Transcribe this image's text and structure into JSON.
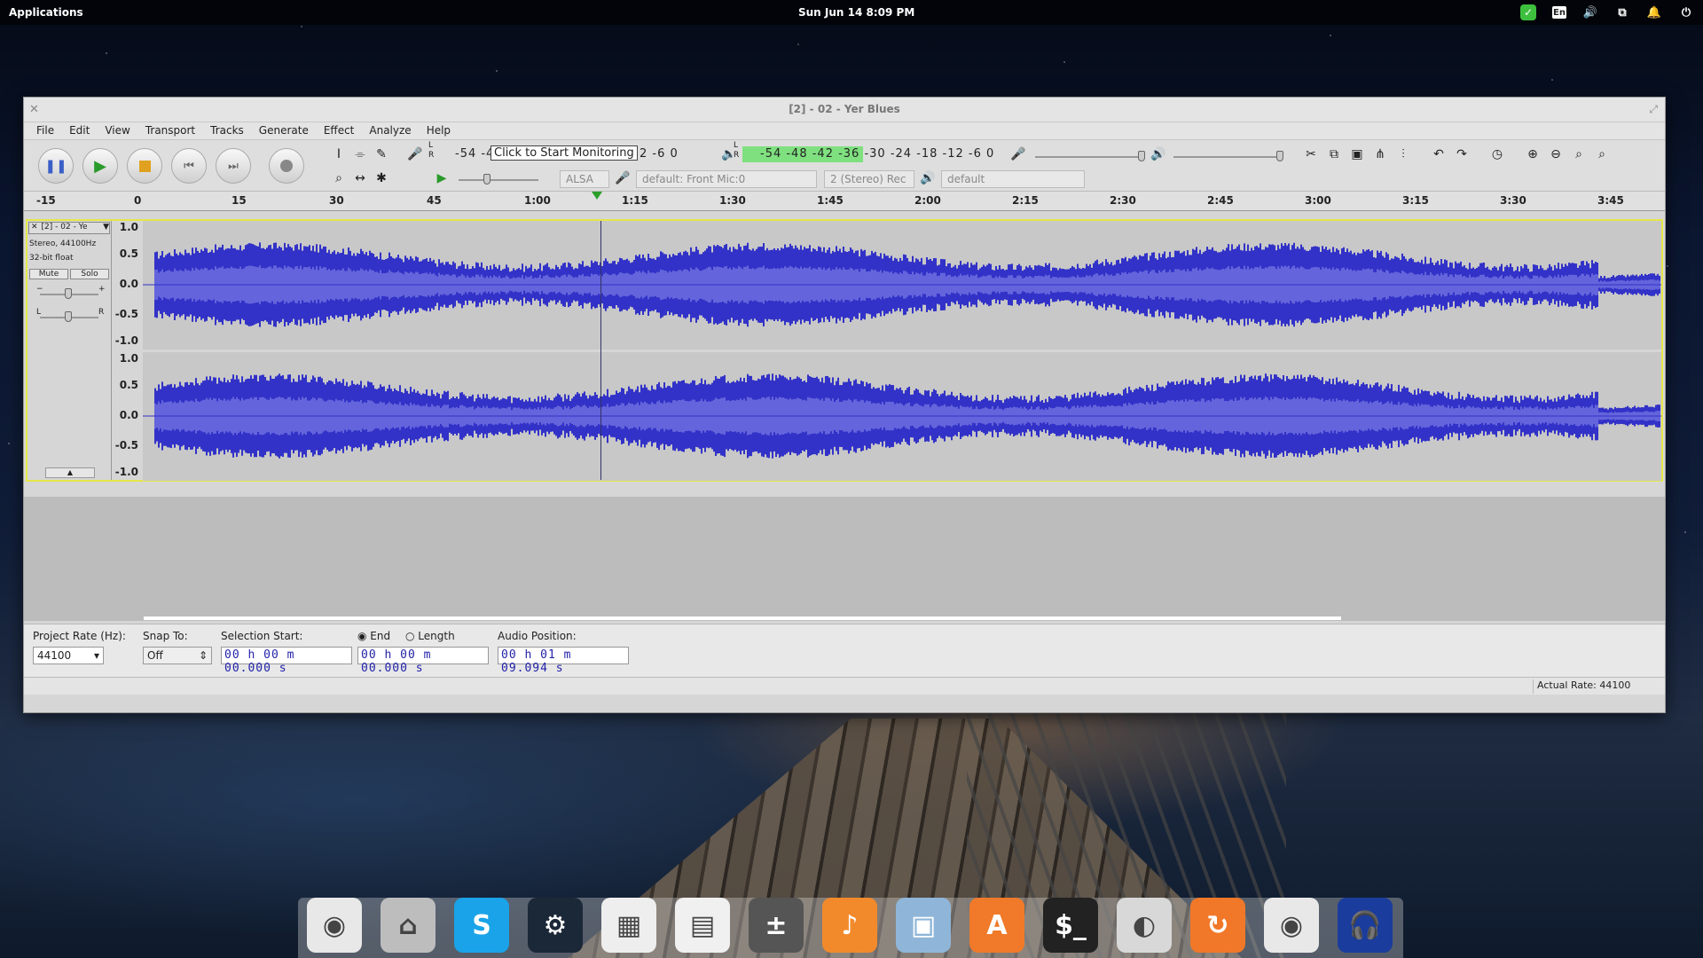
{
  "panel": {
    "applications": "Applications",
    "clock": "Sun Jun 14    8:09 PM",
    "lang": "En"
  },
  "window": {
    "title": "[2] - 02 - Yer Blues"
  },
  "menu": [
    "File",
    "Edit",
    "View",
    "Transport",
    "Tracks",
    "Generate",
    "Effect",
    "Analyze",
    "Help"
  ],
  "meters": {
    "record_scale": "-54  -4",
    "record_tail": "2   -6   0",
    "tooltip": "Click to Start Monitoring",
    "play_scale": "-54  -48  -42  -36  -30  -24  -18  -12   -6   0",
    "lr_top": "L",
    "lr_bottom": "R"
  },
  "device": {
    "host": "ALSA",
    "input": "default: Front Mic:0",
    "channels": "2 (Stereo) Rec",
    "output": "default"
  },
  "ruler": [
    "-15",
    "0",
    "15",
    "30",
    "45",
    "1:00",
    "1:15",
    "1:30",
    "1:45",
    "2:00",
    "2:15",
    "2:30",
    "2:45",
    "3:00",
    "3:15",
    "3:30",
    "3:45"
  ],
  "track": {
    "name": "[2] - 02 - Ye",
    "format": "Stereo, 44100Hz",
    "bitdepth": "32-bit float",
    "mute": "Mute",
    "solo": "Solo",
    "scale": [
      "1.0",
      "0.5",
      "0.0",
      "-0.5",
      "-1.0"
    ]
  },
  "selection": {
    "project_rate_label": "Project Rate (Hz):",
    "project_rate": "44100",
    "snap_label": "Snap To:",
    "snap": "Off",
    "start_label": "Selection Start:",
    "end_label": "End",
    "length_label": "Length",
    "position_label": "Audio Position:",
    "start": "00 h 00 m 00.000 s",
    "end": "00 h 00 m 00.000 s",
    "position": "00 h 01 m 09.094 s"
  },
  "status": {
    "actual_rate": "Actual Rate: 44100"
  },
  "dock": [
    {
      "name": "chrome-icon",
      "color": "#e8e8e8",
      "glyph": "◉"
    },
    {
      "name": "files-icon",
      "color": "#bdbdbd",
      "glyph": "⌂"
    },
    {
      "name": "skype-icon",
      "color": "#1aa3e8",
      "glyph": "S"
    },
    {
      "name": "steam-icon",
      "color": "#1b2838",
      "glyph": "⚙"
    },
    {
      "name": "calendar-icon",
      "color": "#eeeeee",
      "glyph": "▦"
    },
    {
      "name": "document-viewer-icon",
      "color": "#f0f0f0",
      "glyph": "▤"
    },
    {
      "name": "calculator-icon",
      "color": "#555555",
      "glyph": "±"
    },
    {
      "name": "music-icon",
      "color": "#f28a2c",
      "glyph": "♪"
    },
    {
      "name": "photos-icon",
      "color": "#8fb6d8",
      "glyph": "▣"
    },
    {
      "name": "app-center-icon",
      "color": "#f07a2a",
      "glyph": "A"
    },
    {
      "name": "terminal-icon",
      "color": "#222222",
      "glyph": "$_"
    },
    {
      "name": "switchboard-icon",
      "color": "#d8d8d8",
      "glyph": "◐"
    },
    {
      "name": "update-icon",
      "color": "#f07828",
      "glyph": "↻"
    },
    {
      "name": "chrome-icon-2",
      "color": "#e8e8e8",
      "glyph": "◉"
    },
    {
      "name": "headphones-icon",
      "color": "#1a3c9c",
      "glyph": "🎧"
    }
  ]
}
